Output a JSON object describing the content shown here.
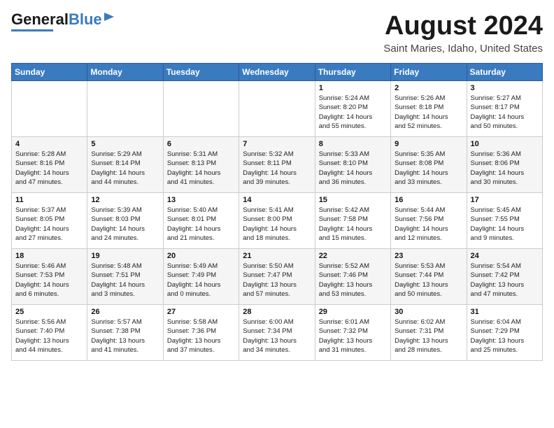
{
  "header": {
    "logo_general": "General",
    "logo_blue": "Blue",
    "month_title": "August 2024",
    "location": "Saint Maries, Idaho, United States"
  },
  "days_of_week": [
    "Sunday",
    "Monday",
    "Tuesday",
    "Wednesday",
    "Thursday",
    "Friday",
    "Saturday"
  ],
  "weeks": [
    [
      {
        "day": "",
        "info": ""
      },
      {
        "day": "",
        "info": ""
      },
      {
        "day": "",
        "info": ""
      },
      {
        "day": "",
        "info": ""
      },
      {
        "day": "1",
        "info": "Sunrise: 5:24 AM\nSunset: 8:20 PM\nDaylight: 14 hours\nand 55 minutes."
      },
      {
        "day": "2",
        "info": "Sunrise: 5:26 AM\nSunset: 8:18 PM\nDaylight: 14 hours\nand 52 minutes."
      },
      {
        "day": "3",
        "info": "Sunrise: 5:27 AM\nSunset: 8:17 PM\nDaylight: 14 hours\nand 50 minutes."
      }
    ],
    [
      {
        "day": "4",
        "info": "Sunrise: 5:28 AM\nSunset: 8:16 PM\nDaylight: 14 hours\nand 47 minutes."
      },
      {
        "day": "5",
        "info": "Sunrise: 5:29 AM\nSunset: 8:14 PM\nDaylight: 14 hours\nand 44 minutes."
      },
      {
        "day": "6",
        "info": "Sunrise: 5:31 AM\nSunset: 8:13 PM\nDaylight: 14 hours\nand 41 minutes."
      },
      {
        "day": "7",
        "info": "Sunrise: 5:32 AM\nSunset: 8:11 PM\nDaylight: 14 hours\nand 39 minutes."
      },
      {
        "day": "8",
        "info": "Sunrise: 5:33 AM\nSunset: 8:10 PM\nDaylight: 14 hours\nand 36 minutes."
      },
      {
        "day": "9",
        "info": "Sunrise: 5:35 AM\nSunset: 8:08 PM\nDaylight: 14 hours\nand 33 minutes."
      },
      {
        "day": "10",
        "info": "Sunrise: 5:36 AM\nSunset: 8:06 PM\nDaylight: 14 hours\nand 30 minutes."
      }
    ],
    [
      {
        "day": "11",
        "info": "Sunrise: 5:37 AM\nSunset: 8:05 PM\nDaylight: 14 hours\nand 27 minutes."
      },
      {
        "day": "12",
        "info": "Sunrise: 5:39 AM\nSunset: 8:03 PM\nDaylight: 14 hours\nand 24 minutes."
      },
      {
        "day": "13",
        "info": "Sunrise: 5:40 AM\nSunset: 8:01 PM\nDaylight: 14 hours\nand 21 minutes."
      },
      {
        "day": "14",
        "info": "Sunrise: 5:41 AM\nSunset: 8:00 PM\nDaylight: 14 hours\nand 18 minutes."
      },
      {
        "day": "15",
        "info": "Sunrise: 5:42 AM\nSunset: 7:58 PM\nDaylight: 14 hours\nand 15 minutes."
      },
      {
        "day": "16",
        "info": "Sunrise: 5:44 AM\nSunset: 7:56 PM\nDaylight: 14 hours\nand 12 minutes."
      },
      {
        "day": "17",
        "info": "Sunrise: 5:45 AM\nSunset: 7:55 PM\nDaylight: 14 hours\nand 9 minutes."
      }
    ],
    [
      {
        "day": "18",
        "info": "Sunrise: 5:46 AM\nSunset: 7:53 PM\nDaylight: 14 hours\nand 6 minutes."
      },
      {
        "day": "19",
        "info": "Sunrise: 5:48 AM\nSunset: 7:51 PM\nDaylight: 14 hours\nand 3 minutes."
      },
      {
        "day": "20",
        "info": "Sunrise: 5:49 AM\nSunset: 7:49 PM\nDaylight: 14 hours\nand 0 minutes."
      },
      {
        "day": "21",
        "info": "Sunrise: 5:50 AM\nSunset: 7:47 PM\nDaylight: 13 hours\nand 57 minutes."
      },
      {
        "day": "22",
        "info": "Sunrise: 5:52 AM\nSunset: 7:46 PM\nDaylight: 13 hours\nand 53 minutes."
      },
      {
        "day": "23",
        "info": "Sunrise: 5:53 AM\nSunset: 7:44 PM\nDaylight: 13 hours\nand 50 minutes."
      },
      {
        "day": "24",
        "info": "Sunrise: 5:54 AM\nSunset: 7:42 PM\nDaylight: 13 hours\nand 47 minutes."
      }
    ],
    [
      {
        "day": "25",
        "info": "Sunrise: 5:56 AM\nSunset: 7:40 PM\nDaylight: 13 hours\nand 44 minutes."
      },
      {
        "day": "26",
        "info": "Sunrise: 5:57 AM\nSunset: 7:38 PM\nDaylight: 13 hours\nand 41 minutes."
      },
      {
        "day": "27",
        "info": "Sunrise: 5:58 AM\nSunset: 7:36 PM\nDaylight: 13 hours\nand 37 minutes."
      },
      {
        "day": "28",
        "info": "Sunrise: 6:00 AM\nSunset: 7:34 PM\nDaylight: 13 hours\nand 34 minutes."
      },
      {
        "day": "29",
        "info": "Sunrise: 6:01 AM\nSunset: 7:32 PM\nDaylight: 13 hours\nand 31 minutes."
      },
      {
        "day": "30",
        "info": "Sunrise: 6:02 AM\nSunset: 7:31 PM\nDaylight: 13 hours\nand 28 minutes."
      },
      {
        "day": "31",
        "info": "Sunrise: 6:04 AM\nSunset: 7:29 PM\nDaylight: 13 hours\nand 25 minutes."
      }
    ]
  ]
}
